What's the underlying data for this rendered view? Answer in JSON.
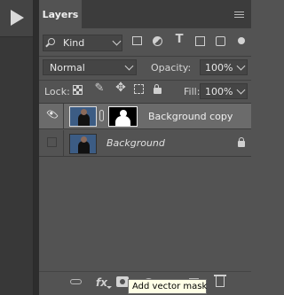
{
  "panel": {
    "tab_label": "Layers"
  },
  "filter": {
    "kind_label": "Kind"
  },
  "blend": {
    "mode": "Normal",
    "opacity_label": "Opacity:",
    "opacity_value": "100%"
  },
  "lock": {
    "label": "Lock:",
    "fill_label": "Fill:",
    "fill_value": "100%"
  },
  "layers": [
    {
      "name": "Background copy",
      "visible": true,
      "selected": true,
      "has_mask": true
    },
    {
      "name": "Background",
      "visible": false,
      "selected": false,
      "locked": true
    }
  ],
  "tooltip": {
    "text": "Add vector mask"
  },
  "colors": {
    "panel_bg": "#535353",
    "selected_row": "#6b6b6b",
    "tooltip_bg": "#ffffe6"
  }
}
